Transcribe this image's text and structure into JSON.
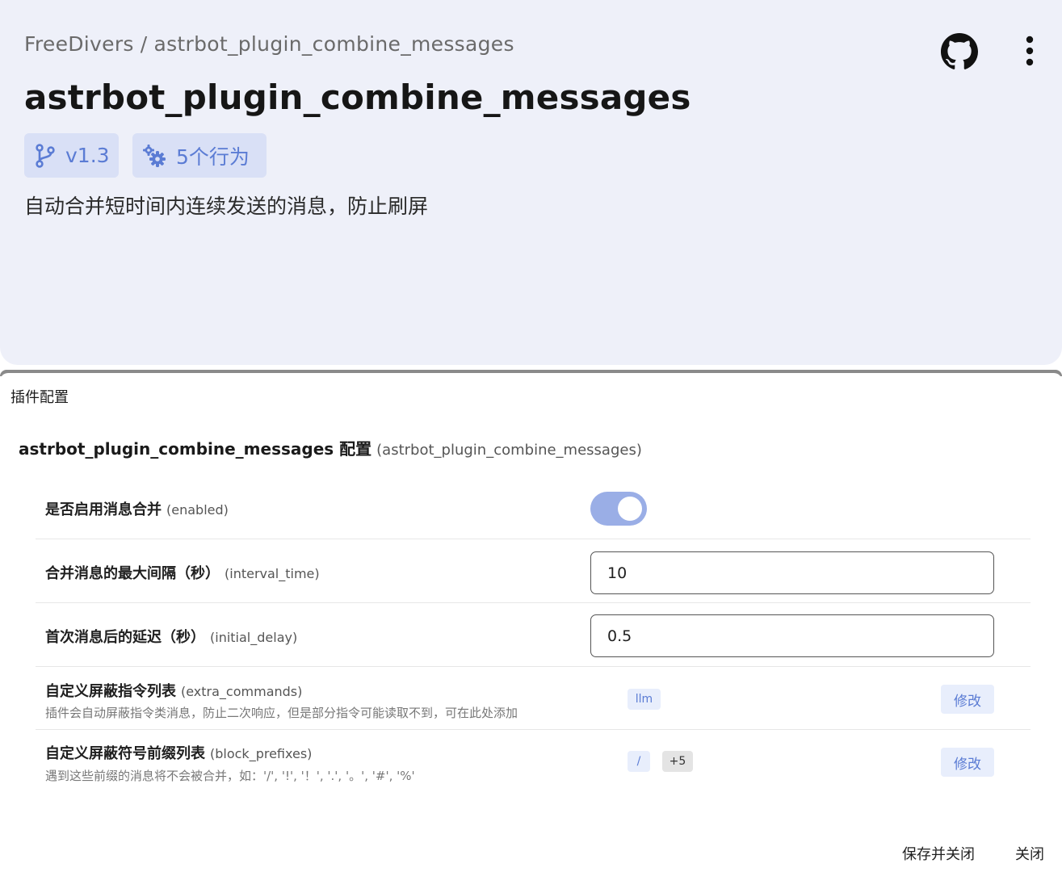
{
  "header": {
    "breadcrumb_owner": "FreeDivers",
    "breadcrumb_separator": "/",
    "breadcrumb_repo": "astrbot_plugin_combine_messages",
    "title": "astrbot_plugin_combine_messages",
    "version_chip": "v1.3",
    "actions_chip": "5个行为",
    "description": "自动合并短时间内连续发送的消息，防止刷屏",
    "icons": [
      "github-icon",
      "more-vertical-icon",
      "branch-icon",
      "gears-icon"
    ]
  },
  "dialog": {
    "title": "插件配置",
    "config_title": "astrbot_plugin_combine_messages 配置",
    "config_key": "(astrbot_plugin_combine_messages)",
    "fields": [
      {
        "label": "是否启用消息合并",
        "key": "(enabled)",
        "type": "toggle",
        "value": true
      },
      {
        "label": "合并消息的最大间隔（秒）",
        "key": "(interval_time)",
        "type": "input",
        "value": "10"
      },
      {
        "label": "首次消息后的延迟（秒）",
        "key": "(initial_delay)",
        "type": "input",
        "value": "0.5"
      },
      {
        "label": "自定义屏蔽指令列表",
        "key": "(extra_commands)",
        "type": "list",
        "hint": "插件会自动屏蔽指令类消息，防止二次响应，但是部分指令可能读取不到，可在此处添加",
        "tags": [
          "llm"
        ],
        "edit_label": "修改"
      },
      {
        "label": "自定义屏蔽符号前缀列表",
        "key": "(block_prefixes)",
        "type": "list",
        "hint": "遇到这些前缀的消息将不会被合并，如：'/', '!', '！', '.', '。', '#', '%'",
        "tags": [
          "/"
        ],
        "more": "+5",
        "edit_label": "修改"
      }
    ],
    "footer": {
      "save_close": "保存并关闭",
      "close": "关闭"
    }
  },
  "colors": {
    "header_bg": "#eef0f9",
    "chip_bg": "#d9e0f6",
    "accent": "#5b7cd4",
    "toggle_on": "#9aaee6"
  }
}
